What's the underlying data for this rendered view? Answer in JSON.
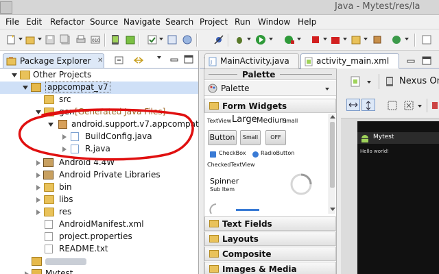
{
  "window": {
    "title": "Java - Mytest/res/la"
  },
  "menu": [
    "File",
    "Edit",
    "Refactor",
    "Source",
    "Navigate",
    "Search",
    "Project",
    "Run",
    "Window",
    "Help"
  ],
  "explorer": {
    "tab_label": "Package Explorer",
    "close_glyph": "✕",
    "tree": [
      {
        "label": "Other Projects",
        "note": ""
      },
      {
        "label": "appcompat_v7",
        "note": ""
      },
      {
        "label": "src",
        "note": ""
      },
      {
        "label": "gen",
        "note": "[Generated Java Files]"
      },
      {
        "label": "android.support.v7.appcompat",
        "note": ""
      },
      {
        "label": "BuildConfig.java",
        "note": ""
      },
      {
        "label": "R.java",
        "note": ""
      },
      {
        "label": "Android 4.4W",
        "note": ""
      },
      {
        "label": "Android Private Libraries",
        "note": ""
      },
      {
        "label": "bin",
        "note": ""
      },
      {
        "label": "libs",
        "note": ""
      },
      {
        "label": "res",
        "note": ""
      },
      {
        "label": "AndroidManifest.xml",
        "note": ""
      },
      {
        "label": "project.properties",
        "note": ""
      },
      {
        "label": "README.txt",
        "note": ""
      },
      {
        "label": "",
        "note": ""
      },
      {
        "label": "Mytest",
        "note": ""
      }
    ]
  },
  "editor": {
    "tabs": [
      {
        "label": "MainActivity.java"
      },
      {
        "label": "activity_main.xml"
      }
    ]
  },
  "palette": {
    "header": "Palette",
    "selector_label": "Palette",
    "drawers": {
      "form_widgets": "Form Widgets",
      "text_fields": "Text Fields",
      "layouts": "Layouts",
      "composite": "Composite",
      "images_media": "Images & Media"
    },
    "widgets": {
      "textview": "TextView",
      "large": "Large",
      "medium": "Medium",
      "small": "Small",
      "button": "Button",
      "small_button": "Small",
      "toggle": "OFF",
      "checkbox": "CheckBox",
      "radio": "RadioButton",
      "checked_textview": "CheckedTextView",
      "spinner": "Spinner",
      "sub_item": "Sub Item"
    }
  },
  "layout_editor": {
    "device": "Nexus One",
    "app_title": "Mytest",
    "hello": "Hello world!"
  },
  "colors": {
    "annotation": "#e01010",
    "selection": "#cfe0f7"
  }
}
